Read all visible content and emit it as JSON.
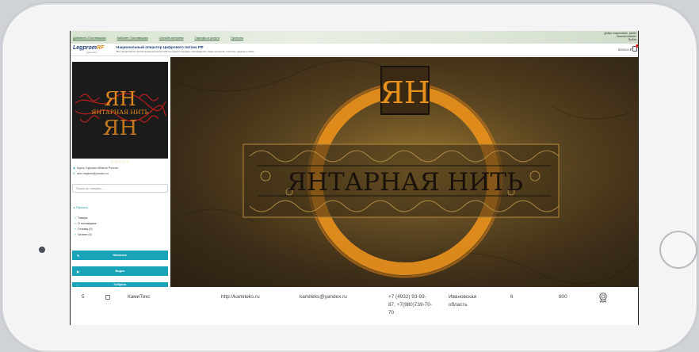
{
  "topnav": {
    "links": [
      "Добавить Поставщика",
      "Кабинет Поставщика",
      "Онлайн-витрина",
      "Тарифы и услуги",
      "Проекты"
    ],
    "user_greeting": [
      "Добро пожаловать, admin",
      "Личный кабинет",
      "Выйти"
    ]
  },
  "brand": {
    "logo_main": "Legprom",
    "logo_accent": "RF",
    "logo_sub": "legpromrf.ru",
    "title": "Национальный оператор Цифрового потока РФ",
    "description": "Все предприятия лёгкой промышленности РФ на одной площадке: производство, заказ на пошив, текстиль, одежда и обувь",
    "balance": "520013 ₽"
  },
  "company": {
    "logo_letters": "ЯН",
    "logo_text": "ЯНТАРНАЯ НИТЬ",
    "rating_stars": "☆☆☆☆☆",
    "address": "Курск, Курская область Россия",
    "email": "alex.mayboe@yandex.ru"
  },
  "sidebar": {
    "search_placeholder": "Поиск по товарам...",
    "section_title": "Проекты",
    "links": [
      "Товары",
      "О поставщике",
      "Отзывы (0)",
      "Читают (0)"
    ],
    "buttons": [
      "Написать",
      "Видео",
      "Собрать"
    ]
  },
  "banner": {
    "monogram": "ЯН",
    "title": "ЯНТАРНАЯ НИТЬ"
  },
  "table_row": {
    "index": "5",
    "name": "КамиТекс",
    "website": "http://kamiteks.ru",
    "email": "kamiteks@yandex.ru",
    "phone": "+7 (4932) 93-93-87, +7(980)739-70-70",
    "region": "Ивановская область",
    "count": "6",
    "amount": "800"
  }
}
